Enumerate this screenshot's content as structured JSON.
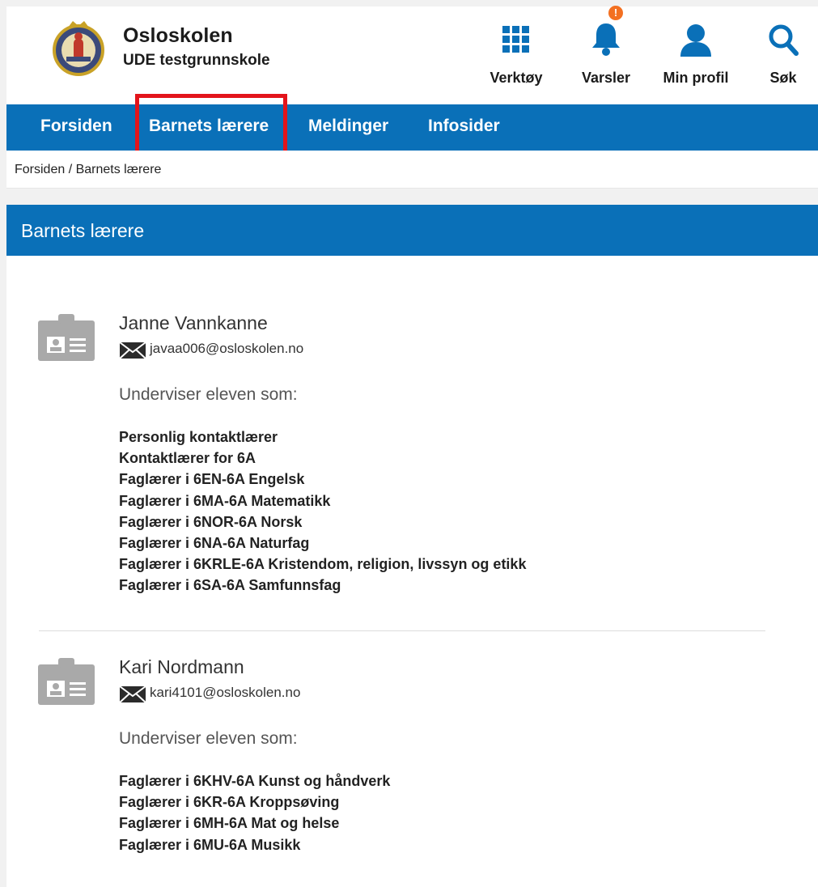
{
  "header": {
    "brand_title": "Osloskolen",
    "brand_subtitle": "UDE testgrunnskole",
    "tools": {
      "verktoy": "Verktøy",
      "varsler": "Varsler",
      "profil": "Min profil",
      "sok": "Søk"
    },
    "notification_badge": "!"
  },
  "nav": {
    "items": [
      "Forsiden",
      "Barnets lærere",
      "Meldinger",
      "Infosider"
    ],
    "active": "Barnets lærere"
  },
  "breadcrumb": {
    "home": "Forsiden",
    "separator": " / ",
    "current": "Barnets lærere"
  },
  "section": {
    "title": "Barnets lærere"
  },
  "teachers": [
    {
      "name": "Janne Vannkanne",
      "email": "javaa006@osloskolen.no",
      "teaches_label": "Underviser eleven som:",
      "roles": [
        "Personlig kontaktlærer",
        "Kontaktlærer for 6A",
        "Faglærer i 6EN-6A Engelsk",
        "Faglærer i 6MA-6A Matematikk",
        "Faglærer i 6NOR-6A Norsk",
        "Faglærer i 6NA-6A Naturfag",
        "Faglærer i 6KRLE-6A Kristendom, religion, livssyn og etikk",
        "Faglærer i 6SA-6A Samfunnsfag"
      ]
    },
    {
      "name": "Kari Nordmann",
      "email": "kari4101@osloskolen.no",
      "teaches_label": "Underviser eleven som:",
      "roles": [
        "Faglærer i 6KHV-6A Kunst og håndverk",
        "Faglærer i 6KR-6A Kroppsøving",
        "Faglærer i 6MH-6A Mat og helse",
        "Faglærer i 6MU-6A Musikk"
      ]
    }
  ],
  "colors": {
    "primary_blue": "#0a70b8",
    "highlight_red": "#e3141b",
    "badge_orange": "#f37021",
    "icon_gray": "#a9a9a9"
  },
  "icons": [
    "oslo-seal-logo",
    "grid-icon",
    "bell-icon",
    "person-icon",
    "search-icon",
    "contact-card-icon",
    "envelope-icon"
  ]
}
